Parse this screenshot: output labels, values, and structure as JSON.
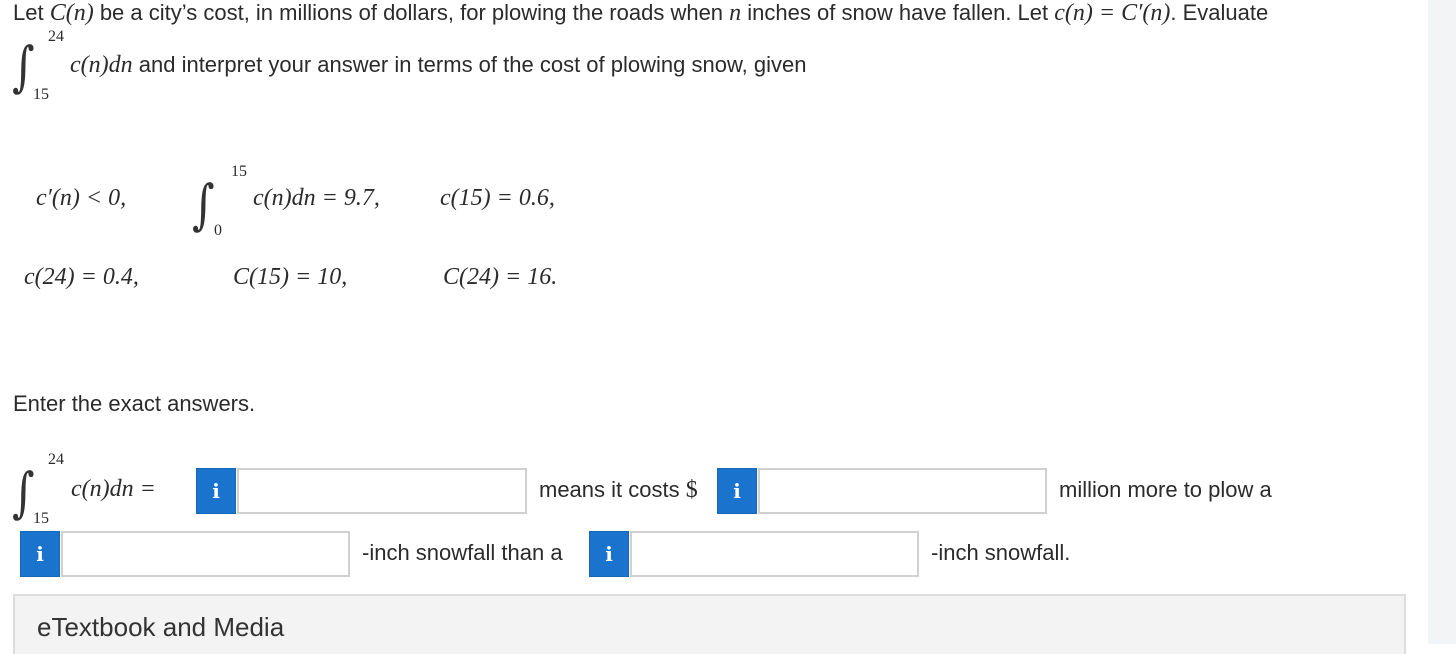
{
  "question": {
    "part1": "Let ",
    "Cn": "C(n)",
    "part2": " be a city’s cost, in millions of dollars, for plowing the roads when ",
    "n": "n",
    "part3": " inches of snow have fallen. Let ",
    "cn_def": "c(n) = C′(n)",
    "part4": ". Evaluate",
    "integral_upper": "24",
    "integral_lower": "15",
    "integrand": "c(n)dn",
    "part5": " and interpret your answer in terms of the cost of plowing snow, given"
  },
  "given": {
    "deriv": "c′(n) < 0,",
    "int_upper": "15",
    "int_lower": "0",
    "int_expr": "c(n)dn = 9.7,",
    "c15": "c(15) = 0.6,",
    "c24": "c(24) = 0.4,",
    "C15": "C(15) = 10,",
    "C24": "C(24) = 16."
  },
  "instruction": "Enter the exact answers.",
  "answer": {
    "int_upper": "24",
    "int_lower": "15",
    "int_expr": "c(n)dn =",
    "means_text": "means it costs",
    "dollar": "$",
    "million_text": "million more to plow a",
    "inch_text1": "-inch snowfall than a",
    "inch_text2": "-inch snowfall.",
    "info_icon_glyph": "i",
    "field1_value": "",
    "field2_value": "",
    "field3_value": "",
    "field4_value": ""
  },
  "etextbook": {
    "label": "eTextbook and Media"
  },
  "colors": {
    "info_button": "#1a73cc",
    "field_border": "#d0d0d0",
    "panel_bg": "#f3f3f3"
  }
}
